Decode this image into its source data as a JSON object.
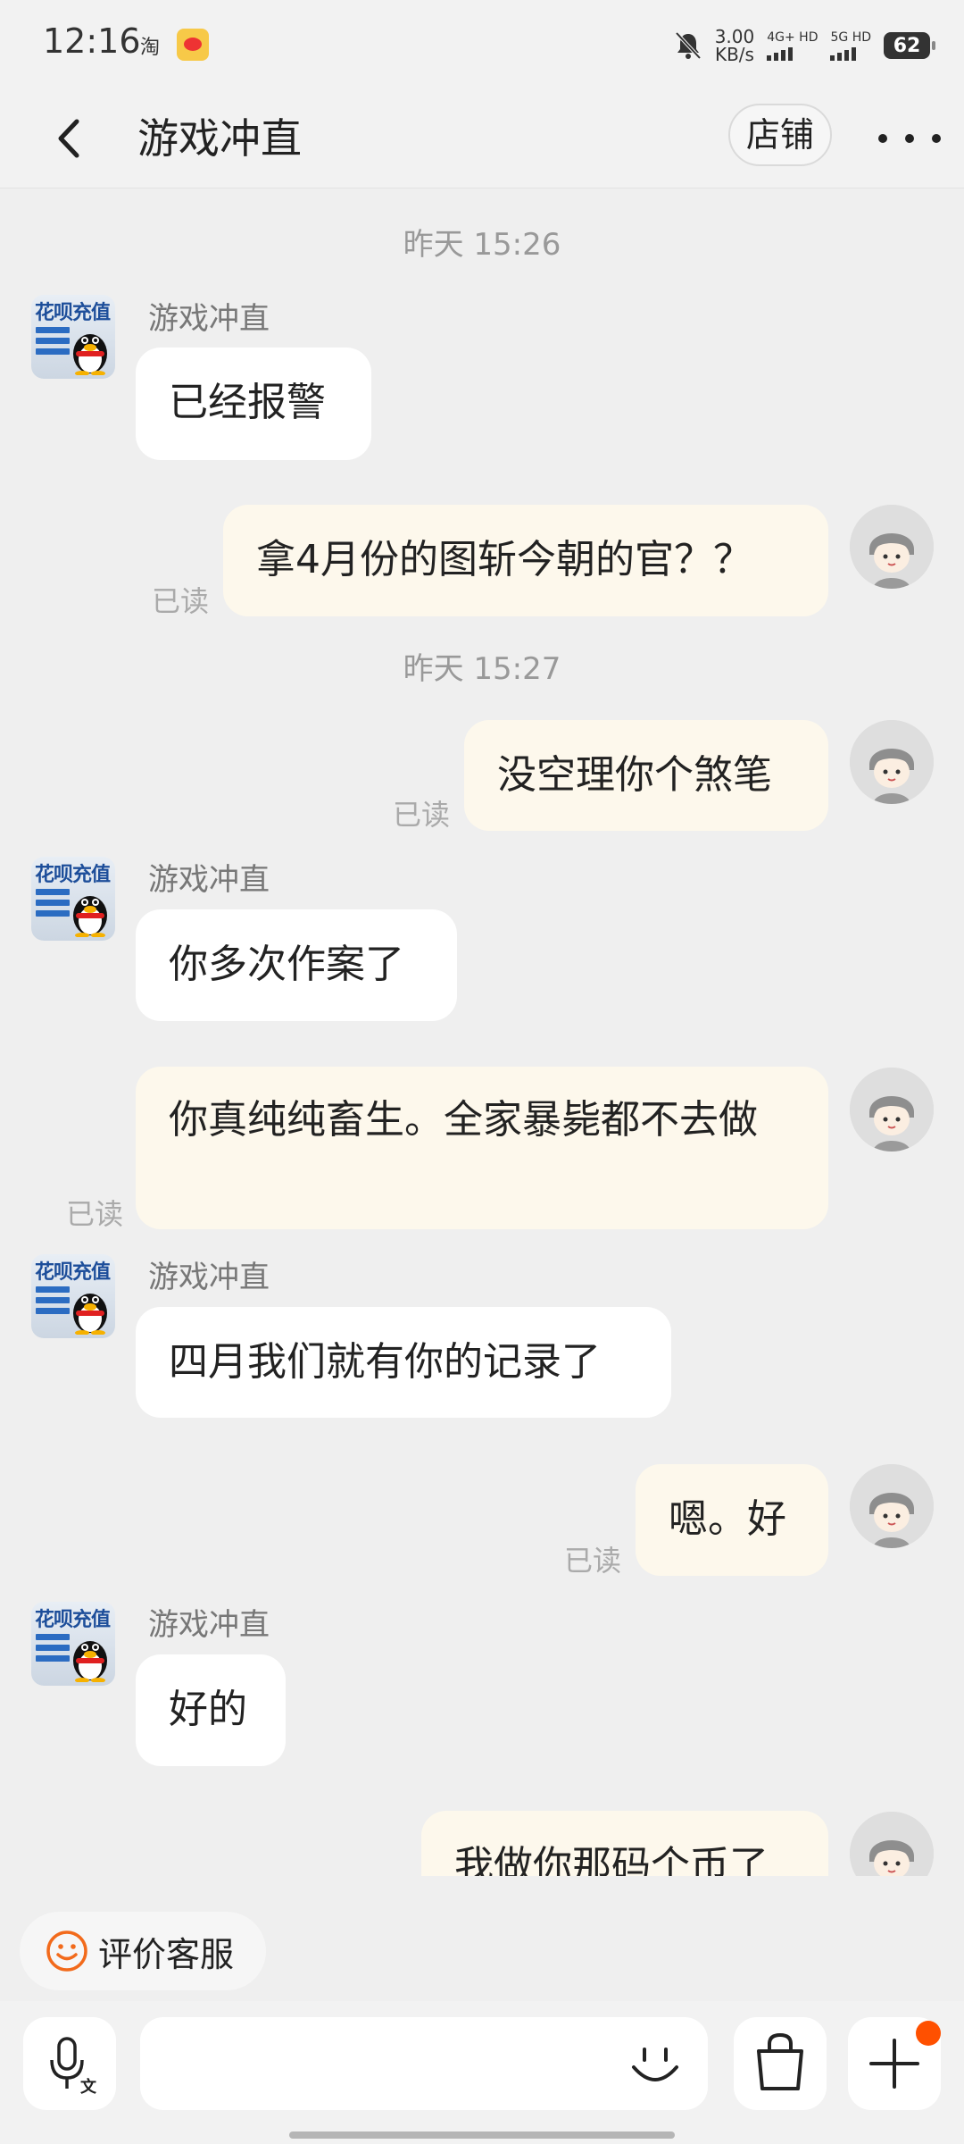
{
  "status_bar": {
    "time": "12:16",
    "taobao_glyph": "淘",
    "speed_value": "3.00",
    "speed_unit": "KB/s",
    "net1": "4G+ HD",
    "net2": "5G HD",
    "battery": "62",
    "icons": [
      "weibo-icon",
      "bell-muted-icon",
      "signal-icon",
      "battery-icon"
    ]
  },
  "header": {
    "title": "游戏冲直",
    "shop_label": "店铺",
    "icons": [
      "back-arrow-icon",
      "more-dots-icon"
    ]
  },
  "shop_avatar": {
    "title_text": "花呗充值"
  },
  "messages": [
    {
      "type": "timestamp",
      "text": "昨天  15:26"
    },
    {
      "type": "incoming",
      "sender": "游戏冲直",
      "text": "已经报警"
    },
    {
      "type": "outgoing",
      "text": "拿4月份的图斩今朝的官？？",
      "status": "已读"
    },
    {
      "type": "timestamp",
      "text": "昨天  15:27"
    },
    {
      "type": "outgoing",
      "text": "没空理你个煞笔",
      "status": "已读"
    },
    {
      "type": "incoming",
      "sender": "游戏冲直",
      "text": "你多次作案了"
    },
    {
      "type": "outgoing",
      "text": "你真纯纯畜生。全家暴毙都不去做",
      "status": "已读"
    },
    {
      "type": "incoming",
      "sender": "游戏冲直",
      "text": "四月我们就有你的记录了"
    },
    {
      "type": "outgoing",
      "text": "嗯。好",
      "status": "已读"
    },
    {
      "type": "incoming",
      "sender": "游戏冲直",
      "text": "好的"
    },
    {
      "type": "outgoing",
      "text": "我做你那码个币了"
    }
  ],
  "rate_button": {
    "label": "评价客服",
    "icon": "smile-face-icon"
  },
  "input_bar": {
    "placeholder": "",
    "icons": [
      "microphone-translate-icon",
      "emoji-icon",
      "shopping-bag-icon",
      "plus-icon"
    ],
    "accent_color": "#ff5000"
  },
  "colors": {
    "background": "#efefef",
    "incoming_bubble": "#ffffff",
    "outgoing_bubble": "#fdf8ec",
    "read_status": "#aaaaaa",
    "smile_orange": "#f26a1b"
  }
}
